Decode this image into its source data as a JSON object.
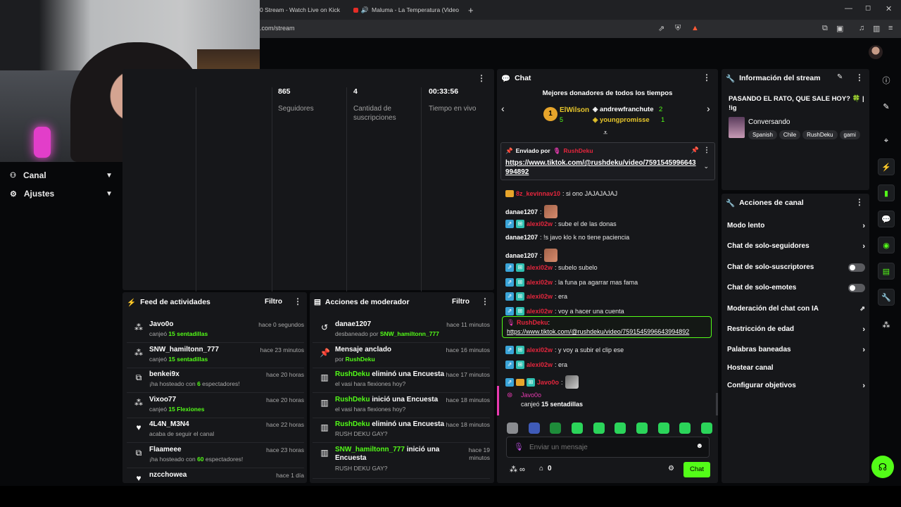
{
  "browser": {
    "tab1": "0 Stream - Watch Live on Kick",
    "tab2": "Maluma - La Temperatura (Video",
    "new_tab": "+",
    "url": ".com/stream",
    "window_min": "—",
    "window_max": "◻",
    "window_close": "✕"
  },
  "nav": {
    "channel": "Canal",
    "settings": "Ajustes"
  },
  "stats": [
    {
      "value": "865",
      "label": "Seguidores"
    },
    {
      "value": "4",
      "label": "Cantidad de suscripciones"
    },
    {
      "value": "00:33:56",
      "label": "Tiempo en vivo"
    }
  ],
  "activity_feed": {
    "title": "Feed de actividades",
    "filter": "Filtro",
    "rows": [
      {
        "icon": "gift-icon",
        "name": "Javo0o",
        "sub_pre": "canjeó ",
        "sub_hl": "15 sentadillas",
        "sub_post": "",
        "time": "hace 0 segundos"
      },
      {
        "icon": "gift-icon",
        "name": "SNW_hamiltonn_777",
        "sub_pre": "canjeó ",
        "sub_hl": "15 sentadillas",
        "sub_post": "",
        "time": "hace 23 minutos"
      },
      {
        "icon": "host-icon",
        "name": "benkei9x",
        "sub_pre": "¡ha hosteado con ",
        "sub_hl": "6",
        "sub_post": " espectadores!",
        "time": "hace 20 horas"
      },
      {
        "icon": "gift-icon",
        "name": "Vixoo77",
        "sub_pre": "canjeó ",
        "sub_hl": "15 Flexiones",
        "sub_post": "",
        "time": "hace 20 horas"
      },
      {
        "icon": "heart-icon",
        "name": "4L4N_M3N4",
        "sub_pre": "acaba de seguir el canal",
        "sub_hl": "",
        "sub_post": "",
        "time": "hace 22 horas"
      },
      {
        "icon": "host-icon",
        "name": "Flaameee",
        "sub_pre": "¡ha hosteado con ",
        "sub_hl": "60",
        "sub_post": " espectadores!",
        "time": "hace 23 horas"
      },
      {
        "icon": "heart-icon",
        "name": "nzcchowea",
        "sub_pre": "",
        "sub_hl": "",
        "sub_post": "",
        "time": "hace 1 día"
      }
    ]
  },
  "mod_actions": {
    "title": "Acciones de moderador",
    "filter": "Filtro",
    "rows": [
      {
        "icon": "undo-icon",
        "name": "danae1207",
        "name_green": false,
        "action": "",
        "sub_pre": "desbaneado por ",
        "sub_hl": "SNW_hamiltonn_777",
        "time": "hace 11 minutos"
      },
      {
        "icon": "pin-icon",
        "name": "Mensaje anclado",
        "name_green": false,
        "action": "",
        "sub_pre": "por ",
        "sub_hl": "RushDeku",
        "time": "hace 16 minutos"
      },
      {
        "icon": "poll-icon",
        "name": "RushDeku",
        "name_green": true,
        "action": " eliminó una Encuesta",
        "sub_pre": "el vasi hara flexiones hoy?",
        "sub_hl": "",
        "time": "hace 17 minutos"
      },
      {
        "icon": "poll-icon",
        "name": "RushDeku",
        "name_green": true,
        "action": " inició una Encuesta",
        "sub_pre": "el vasi hara flexiones hoy?",
        "sub_hl": "",
        "time": "hace 18 minutos"
      },
      {
        "icon": "poll-icon",
        "name": "RushDeku",
        "name_green": true,
        "action": " eliminó una Encuesta",
        "sub_pre": "RUSH DEKU GAY?",
        "sub_hl": "",
        "time": "hace 18 minutos"
      },
      {
        "icon": "poll-icon",
        "name": "SNW_hamiltonn_777",
        "name_green": true,
        "action": " inició una Encuesta",
        "sub_pre": "RUSH DEKU GAY?",
        "sub_hl": "",
        "time": "hace 19 minutos"
      }
    ]
  },
  "chat": {
    "title": "Chat",
    "top_donors_title": "Mejores donadores de todos los tiempos",
    "donor1": {
      "rank": "1",
      "name": "ElWilson",
      "amount": "5"
    },
    "donor2": {
      "name": "andrewfranchute",
      "amount": "2"
    },
    "donor3": {
      "name": "youngpromisse",
      "amount": "1"
    },
    "pinned_label": "Enviado por",
    "pinned_user": "RushDeku",
    "pinned_link": "https://www.tiktok.com/@rushdeku/video/7591545996643994892",
    "messages": [
      {
        "user": "8z_kevinnav10",
        "text": ": si ono JAJAJAJAJ"
      },
      {
        "user": "danae1207",
        "text": ":"
      },
      {
        "user": "alexi02w",
        "text": ": sube el de las donas"
      },
      {
        "user": "danae1207",
        "text": ": !s javo klo k no tiene paciencia"
      },
      {
        "user": "danae1207",
        "text": ":"
      },
      {
        "user": "alexi02w",
        "text": ": subelo subelo"
      },
      {
        "user": "alexi02w",
        "text": ": la funa pa agarrar mas fama"
      },
      {
        "user": "alexi02w",
        "text": ": era"
      },
      {
        "user": "alexi02w",
        "text": ": voy a hacer una cuenta"
      },
      {
        "user": "RushDeku",
        "text": ":"
      },
      {
        "user": "alexi02w",
        "text": ": y voy a subir el clip ese"
      },
      {
        "user": "alexi02w",
        "text": ": era"
      },
      {
        "user": "Javo0o",
        "text": ":"
      }
    ],
    "highlight_link": "https://www.tiktok.com/@rushdeku/video/7591545996643994892",
    "redeem_user": "Javo0o",
    "redeem_text_pre": "canjeó ",
    "redeem_text_hl": "15 sentadillas",
    "input_placeholder": "Enviar un mensaje",
    "infinity": "∞",
    "count": "0",
    "send": "Chat"
  },
  "stream_info": {
    "title": "Información del stream",
    "stream_title": "PASANDO EL RATO, QUE SALE HOY? 🍀 | !ig",
    "category": "Conversando",
    "tags": [
      "Spanish",
      "Chile",
      "RushDeku",
      "gami"
    ]
  },
  "channel_actions": {
    "title": "Acciones de canal",
    "items": [
      {
        "label": "Modo lento",
        "control": "chevron"
      },
      {
        "label": "Chat de solo-seguidores",
        "control": "chevron"
      },
      {
        "label": "Chat de solo-suscriptores",
        "control": "toggle"
      },
      {
        "label": "Chat de solo-emotes",
        "control": "toggle"
      },
      {
        "label": "Moderación del chat con IA",
        "control": "external"
      },
      {
        "label": "Restricción de edad",
        "control": "chevron"
      },
      {
        "label": "Palabras baneadas",
        "control": "chevron"
      },
      {
        "label": "Hostear canal",
        "control": "none"
      },
      {
        "label": "Configurar objetivos",
        "control": "chevron"
      }
    ]
  },
  "colors": {
    "accent": "#53fc18",
    "panel": "#16171a",
    "bg": "#07080a",
    "user_red": "#e5263d"
  }
}
